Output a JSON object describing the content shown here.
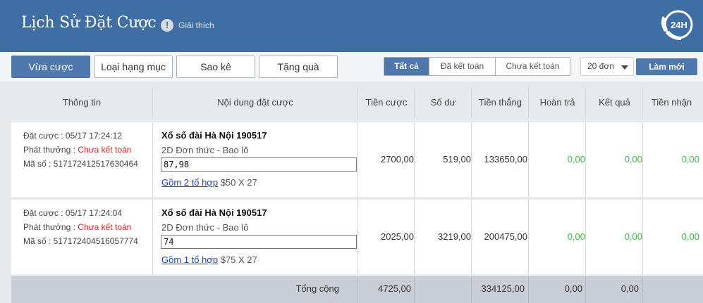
{
  "header": {
    "title": "Lịch Sử Đặt Cược",
    "help_label": "Giải thích",
    "support_badge": "24H"
  },
  "toolbar": {
    "tabs": [
      "Vừa cược",
      "Loại hạng mục",
      "Sao kê",
      "Tặng quà"
    ],
    "filters": [
      "Tất cả",
      "Đã kết toán",
      "Chưa kết toán"
    ],
    "page_size": "20 đơn",
    "refresh_label": "Làm mới"
  },
  "table": {
    "columns": [
      "Thông tin",
      "Nội dung đặt cược",
      "Tiền cược",
      "Số dư",
      "Tiền thắng",
      "Hoàn trả",
      "Kết quả",
      "Tiền nhận"
    ],
    "rows": [
      {
        "placed": "Đặt cược : 05/17 17:24:12",
        "payout_label": "Phát thưởng : ",
        "payout_status": "Chưa kết toán",
        "code": "Mã số : 517172412517630464",
        "game": "Xổ số đài Hà Nội 190517",
        "bet_type": "2D Đơn thức - Bao lô",
        "numbers": "87,98",
        "combo_link": "Gồm 2 tổ hợp",
        "combo_detail": "$50 X 27",
        "stake": "2700,00",
        "balance": "519,00",
        "win": "133650,00",
        "refund": "0,00",
        "result": "0,00",
        "received": "0,00"
      },
      {
        "placed": "Đặt cược : 05/17 17:24:04",
        "payout_label": "Phát thưởng : ",
        "payout_status": "Chưa kết toán",
        "code": "Mã số : 517172404516057774",
        "game": "Xổ số đài Hà Nội 190517",
        "bet_type": "2D Đơn thức - Bao lô",
        "numbers": "74",
        "combo_link": "Gồm 1 tổ hợp",
        "combo_detail": "$75 X 27",
        "stake": "2025,00",
        "balance": "3219,00",
        "win": "200475,00",
        "refund": "0,00",
        "result": "0,00",
        "received": "0,00"
      }
    ],
    "totals": {
      "label": "Tổng cộng",
      "stake": "4725,00",
      "win": "334125,00",
      "refund": "0,00",
      "result": "0,00"
    }
  },
  "colors": {
    "header_bg": "#3e6ea4",
    "accent": "#4e78ad",
    "status_red": "#e02020",
    "value_green": "#3cb64a",
    "link_blue": "#1a3fd6"
  }
}
